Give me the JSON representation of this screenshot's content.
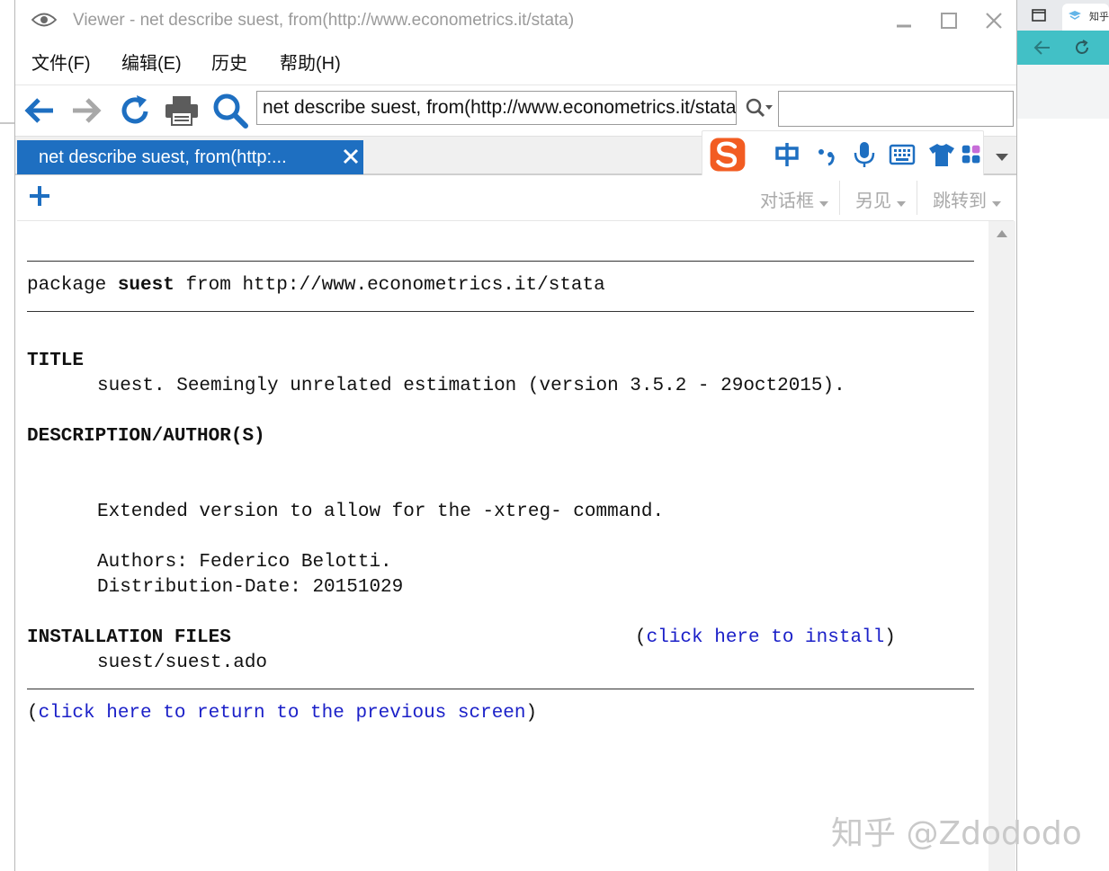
{
  "window": {
    "title": "Viewer - net describe suest, from(http://www.econometrics.it/stata)"
  },
  "menu": [
    {
      "label": "文件(F)"
    },
    {
      "label": "编辑(E)"
    },
    {
      "label": "历史"
    },
    {
      "label": "帮助(H)"
    }
  ],
  "toolbar": {
    "command_value": "net describe suest, from(http://www.econometrics.it/stata)",
    "find_value": ""
  },
  "tab": {
    "label": "net describe suest, from(http:..."
  },
  "subtoolbar": {
    "dialog_label": "对话框",
    "also_see_label": "另见",
    "jump_label": "跳转到"
  },
  "content": {
    "package_prefix": "package ",
    "package_name": "suest",
    "package_suffix": " from http://www.econometrics.it/stata",
    "title_heading": "TITLE",
    "title_text": "suest. Seemingly unrelated estimation (version 3.5.2 - 29oct2015).",
    "desc_heading": "DESCRIPTION/AUTHOR(S)",
    "desc_line1": "Extended version to allow for the -xtreg- command.",
    "authors_line": "Authors: Federico Belotti.",
    "date_line": "Distribution-Date: 20151029",
    "install_heading": "INSTALLATION FILES",
    "install_link": "click here to install",
    "install_file": "suest/suest.ado",
    "return_link": "click here to return to the previous screen",
    "paren_open": "(",
    "paren_close": ")"
  },
  "background": {
    "tab_text": "知乎"
  },
  "watermark": "知乎 @Zdododo",
  "colors": {
    "tab_active": "#1e6fc1",
    "link": "#1b20c8",
    "toolbar_icon": "#1e6fc1",
    "background_accent": "#42c0c6",
    "ime_logo": "#f25c22"
  }
}
